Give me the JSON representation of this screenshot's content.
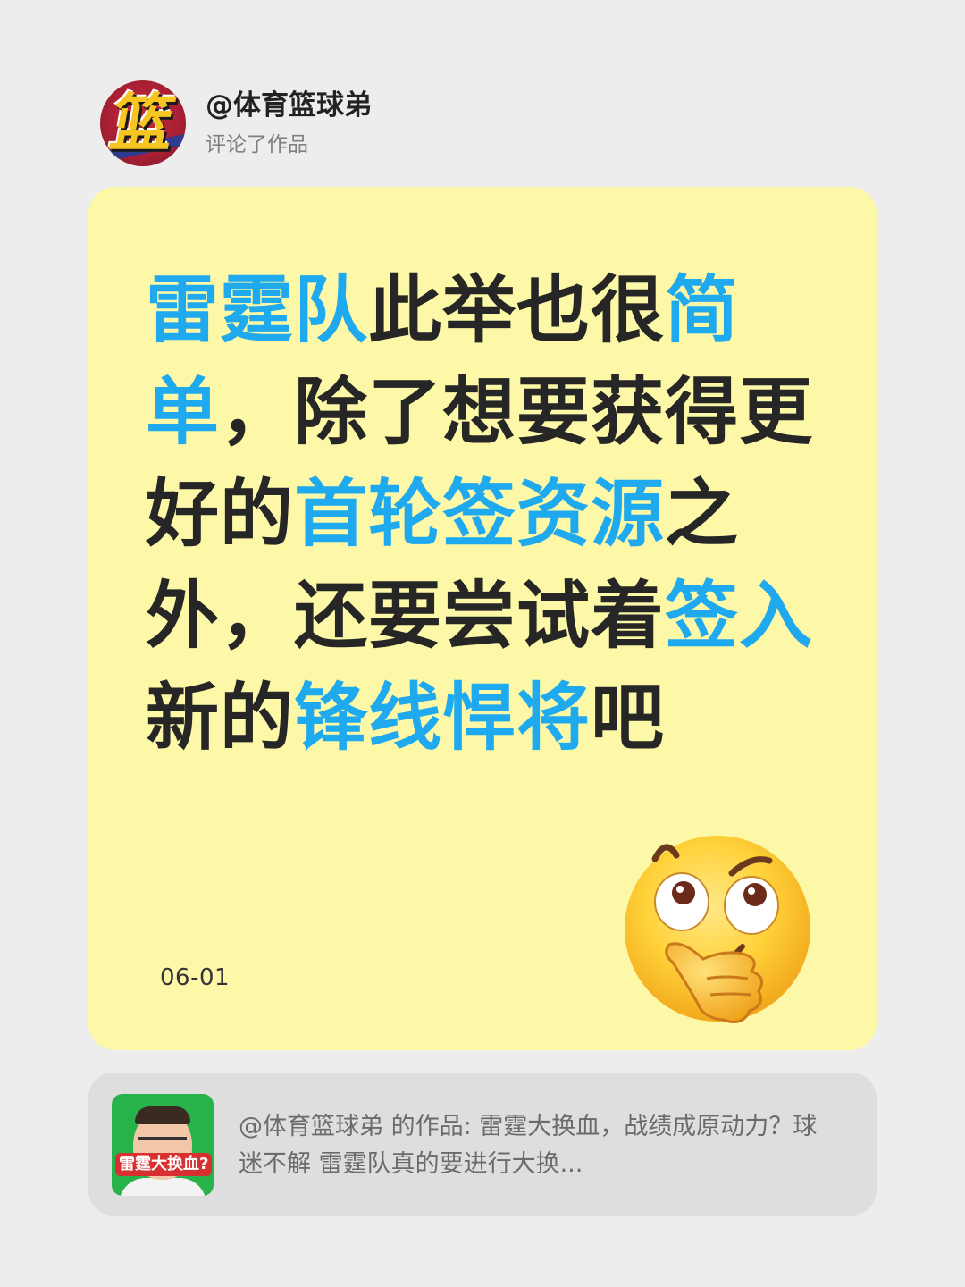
{
  "header": {
    "username": "@体育篮球弟",
    "action": "评论了作品",
    "avatar_glyph": "篮"
  },
  "card": {
    "comment_segments": [
      {
        "text": "雷霆队",
        "highlight": true
      },
      {
        "text": "此举也很",
        "highlight": false
      },
      {
        "text": "简单",
        "highlight": true
      },
      {
        "text": "，除了想要获得更好的",
        "highlight": false
      },
      {
        "text": "首轮签资源",
        "highlight": true
      },
      {
        "text": "之外，还要尝试着",
        "highlight": false
      },
      {
        "text": "签入",
        "highlight": true
      },
      {
        "text": "新的",
        "highlight": false
      },
      {
        "text": "锋线悍将",
        "highlight": true
      },
      {
        "text": "吧",
        "highlight": false
      }
    ],
    "date": "06-01",
    "emoji_icon": "thinking-face"
  },
  "reference": {
    "thumbnail_label": "雷霆大换血?",
    "text": "@体育篮球弟 的作品: 雷霆大换血，战绩成原动力？球迷不解 雷霆队真的要进行大换..."
  },
  "colors": {
    "background": "#ededed",
    "card": "#fdf8a8",
    "highlight": "#1fa9ee",
    "text": "#262626",
    "reference_bg": "#dedede"
  }
}
